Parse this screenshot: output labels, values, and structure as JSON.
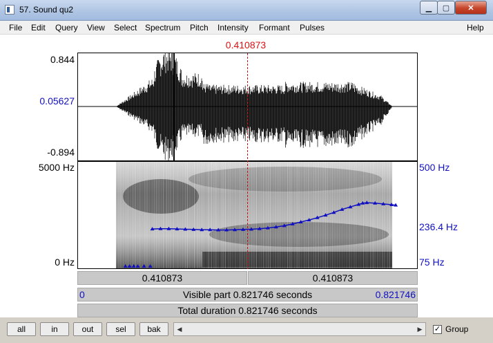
{
  "window": {
    "title": "57. Sound qu2"
  },
  "menu": [
    "File",
    "Edit",
    "Query",
    "View",
    "Select",
    "Spectrum",
    "Pitch",
    "Intensity",
    "Formant",
    "Pulses",
    "Help"
  ],
  "cursor": {
    "time_label": "0.410873",
    "time": 0.410873
  },
  "waveform": {
    "ymax_label": "0.844",
    "ycursor_label": "0.05627",
    "ymin_label": "-0.894"
  },
  "spectrogram": {
    "fmax_label": "5000 Hz",
    "fmin_label": "0 Hz"
  },
  "pitch": {
    "max_label": "500 Hz",
    "mid_label": "236.4 Hz",
    "min_label": "75 Hz"
  },
  "selection_bar": {
    "left_label": "0.410873",
    "right_label": "0.410873"
  },
  "visible": {
    "start_label": "0",
    "text": "Visible part 0.821746 seconds",
    "end_label": "0.821746"
  },
  "total": {
    "text": "Total duration 0.821746 seconds"
  },
  "toolbar": {
    "all": "all",
    "in": "in",
    "out": "out",
    "sel": "sel",
    "bak": "bak",
    "group_label": "Group",
    "group_checked": "✓"
  },
  "colors": {
    "cursor": "#d11111",
    "pitch": "#1010c0",
    "bars": "#c8c8c8"
  },
  "chart_data": {
    "type": "line",
    "x_range": [
      0,
      0.821746
    ],
    "pitch_range_hz": [
      75,
      500
    ],
    "series": [
      {
        "values": [
          [
            0.115,
            78
          ],
          [
            0.125,
            76
          ],
          [
            0.135,
            72
          ],
          [
            0.145,
            68
          ],
          [
            0.16,
            70
          ],
          [
            0.175,
            67
          ],
          [
            0.18,
            232
          ],
          [
            0.2,
            233
          ],
          [
            0.22,
            233
          ],
          [
            0.24,
            232
          ],
          [
            0.26,
            231
          ],
          [
            0.28,
            230
          ],
          [
            0.3,
            229
          ],
          [
            0.32,
            229
          ],
          [
            0.34,
            228
          ],
          [
            0.36,
            228
          ],
          [
            0.38,
            229
          ],
          [
            0.4,
            230
          ],
          [
            0.42,
            231
          ],
          [
            0.44,
            233
          ],
          [
            0.46,
            236
          ],
          [
            0.48,
            240
          ],
          [
            0.5,
            245
          ],
          [
            0.52,
            252
          ],
          [
            0.54,
            260
          ],
          [
            0.56,
            268
          ],
          [
            0.58,
            277
          ],
          [
            0.6,
            287
          ],
          [
            0.62,
            298
          ],
          [
            0.64,
            310
          ],
          [
            0.66,
            320
          ],
          [
            0.68,
            330
          ],
          [
            0.69,
            335
          ],
          [
            0.7,
            337
          ],
          [
            0.72,
            335
          ],
          [
            0.74,
            332
          ],
          [
            0.76,
            329
          ],
          [
            0.77,
            327
          ]
        ]
      }
    ]
  }
}
